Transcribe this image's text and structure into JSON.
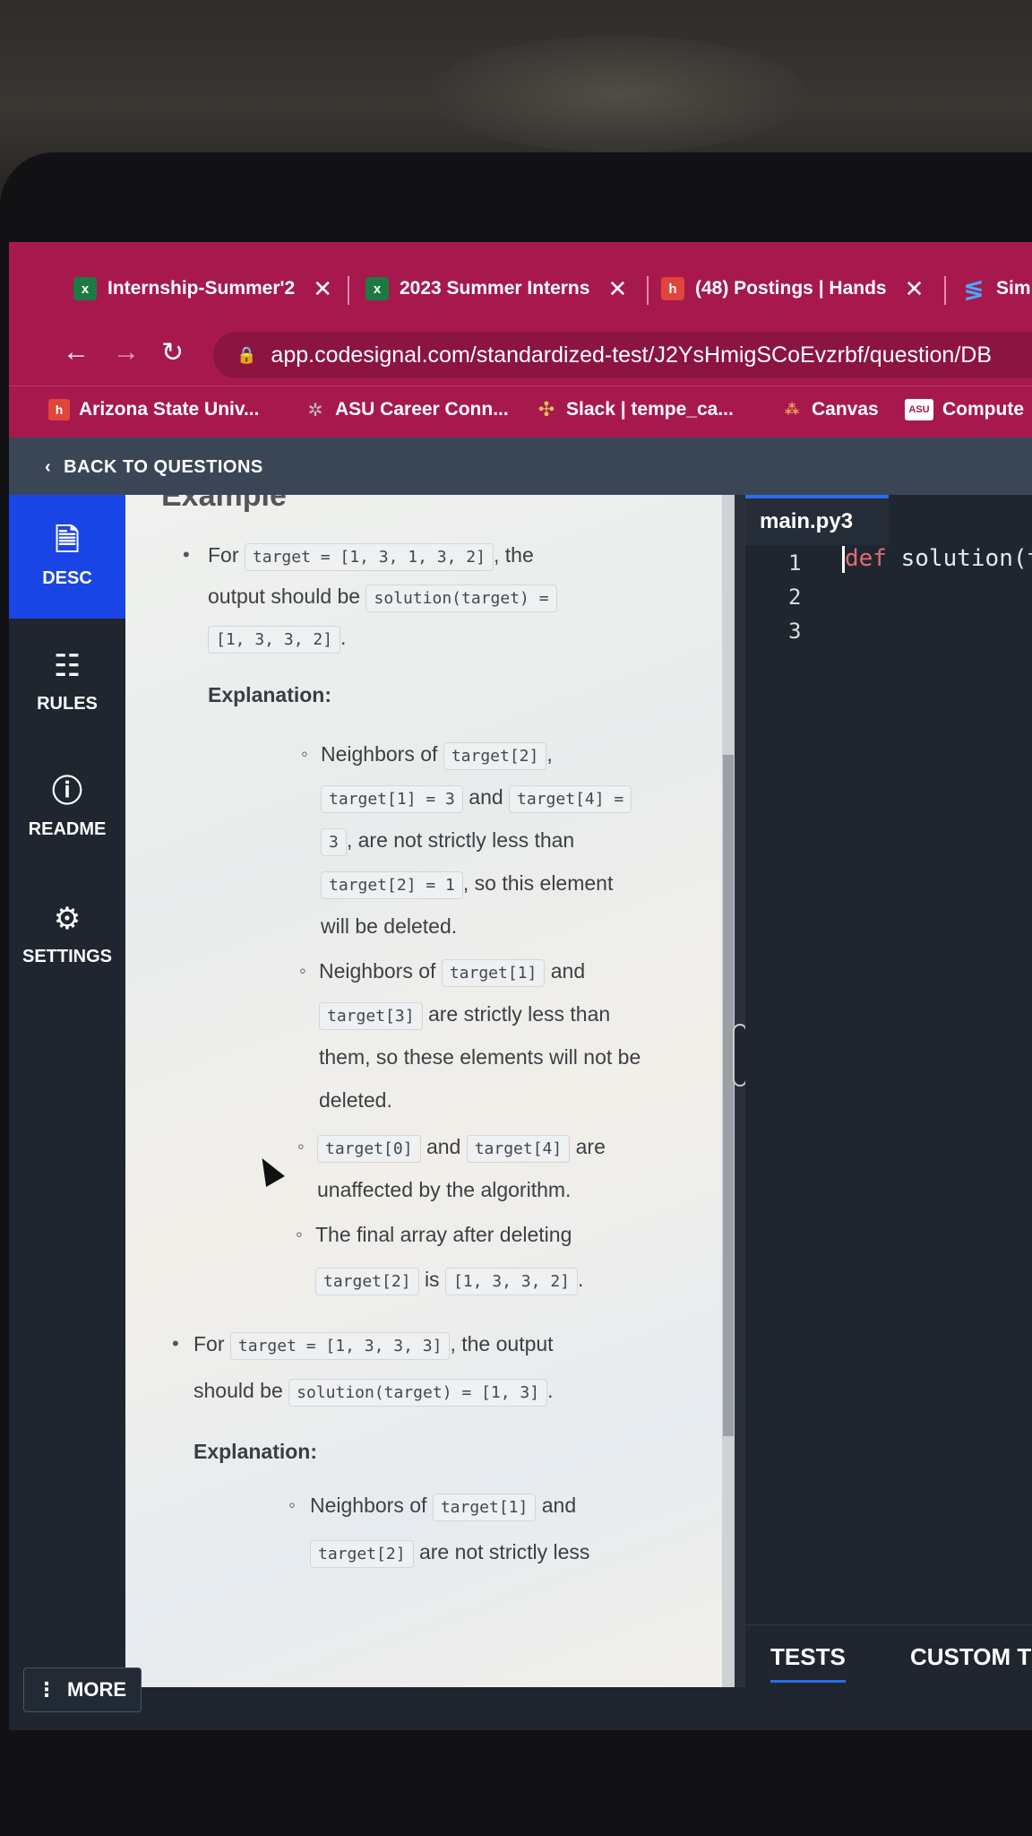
{
  "tabs": [
    {
      "title": "Internship-Summer'2",
      "icon": "excel-icon"
    },
    {
      "title": "2023 Summer Interns",
      "icon": "excel-icon"
    },
    {
      "title": "(48) Postings | Hands",
      "icon": "handshake-icon"
    },
    {
      "title": "Sim",
      "icon": "simplify-icon"
    }
  ],
  "address_bar": {
    "url": "app.codesignal.com/standardized-test/J2YsHmigSCoEvzrbf/question/DB"
  },
  "bookmarks": [
    {
      "label": "Arizona State Univ...",
      "icon": "handshake-icon"
    },
    {
      "label": "ASU Career Conn...",
      "icon": "gear-icon"
    },
    {
      "label": "Slack | tempe_ca...",
      "icon": "slack-icon"
    },
    {
      "label": "Canvas",
      "icon": "canvas-icon"
    },
    {
      "label": "Compute",
      "icon": "asu-icon"
    }
  ],
  "back_label": "BACK TO QUESTIONS",
  "sidebar": {
    "items": [
      {
        "label": "DESC",
        "icon": "document-icon",
        "active": true
      },
      {
        "label": "RULES",
        "icon": "list-icon"
      },
      {
        "label": "README",
        "icon": "info-icon"
      },
      {
        "label": "SETTINGS",
        "icon": "gear-icon"
      }
    ],
    "more": "MORE"
  },
  "description": {
    "heading": "Example",
    "ex1": {
      "for": "For",
      "code_target": "target = [1, 3, 1, 3, 2]",
      "the": ", the",
      "output_should_be": "output should be",
      "code_solution": "solution(target) =",
      "code_result": "[1, 3, 3, 2]",
      "period": ".",
      "explanation": "Explanation:",
      "b1_neighbors_of": "Neighbors of",
      "b1_code1": "target[2]",
      "b1_comma": ",",
      "b1_code2": "target[1] = 3",
      "b1_and": "and",
      "b1_code3": "target[4] =",
      "b1_code4": "3",
      "b1_text2": ", are not strictly less than",
      "b1_code5": "target[2] = 1",
      "b1_text3": ", so this element",
      "b1_text4": "will be deleted.",
      "b2_neighbors_of": "Neighbors of",
      "b2_code1": "target[1]",
      "b2_and": "and",
      "b2_code2": "target[3]",
      "b2_text1": "are strictly less than",
      "b2_text2": "them, so these elements will not be",
      "b2_text3": "deleted.",
      "b3_code1": "target[0]",
      "b3_and": "and",
      "b3_code2": "target[4]",
      "b3_are": "are",
      "b3_text": "unaffected by the algorithm.",
      "b4_text": "The final array after deleting",
      "b4_code1": "target[2]",
      "b4_is": "is",
      "b4_code2": "[1, 3, 3, 2]",
      "b4_period": "."
    },
    "ex2": {
      "for": "For",
      "code_target": "target = [1, 3, 3, 3]",
      "text1": ", the output",
      "should_be": "should be",
      "code_solution": "solution(target) = [1, 3]",
      "period": ".",
      "explanation": "Explanation:",
      "b1_neighbors_of": "Neighbors of",
      "b1_code1": "target[1]",
      "b1_and": "and",
      "b1_code2": "target[2]",
      "b1_text": "are not strictly less"
    }
  },
  "editor": {
    "filename": "main.py3",
    "line_numbers": [
      "1",
      "2",
      "3"
    ],
    "code_keyword": "def",
    "code_rest": " solution(ta",
    "bottom_tabs": [
      "TESTS",
      "CUSTOM T"
    ]
  }
}
